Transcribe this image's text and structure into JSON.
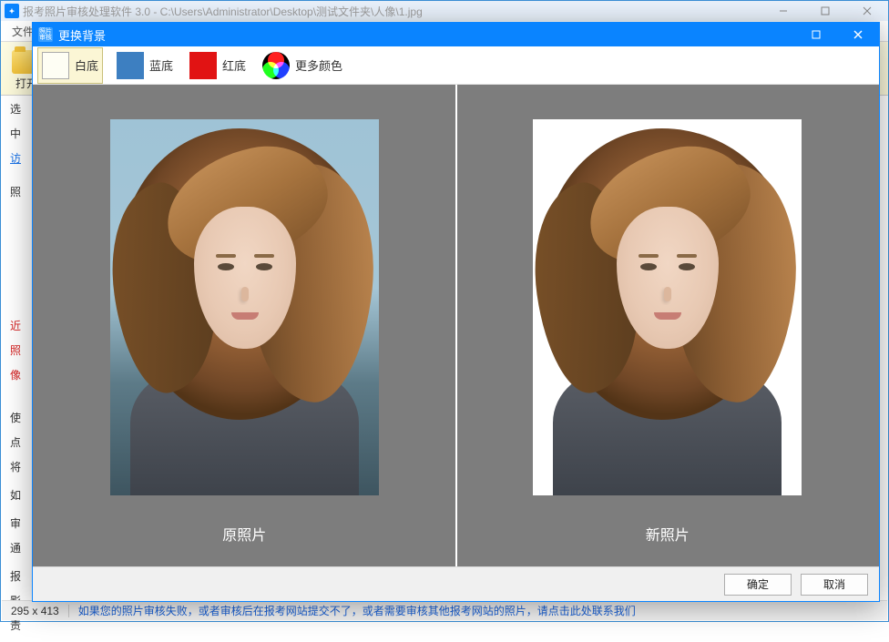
{
  "parent": {
    "title": "报考照片审核处理软件 3.0 - C:\\Users\\Administrator\\Desktop\\测试文件夹\\人像\\1.jpg",
    "menu_file": "文件",
    "toolbar_open": "打开",
    "left_items": {
      "l1": "选",
      "l2": "中",
      "l3": "访",
      "l4": "照",
      "l5": "近",
      "l6": "照",
      "l7": "像",
      "l8": "使",
      "l9": "点",
      "l10": "将",
      "l11": "如",
      "l12": "审",
      "l13": "通",
      "l14": "报",
      "l15": "影",
      "l16": "责"
    }
  },
  "status": {
    "dimensions": "295 x 413",
    "hint": "如果您的照片审核失败，或者审核后在报考网站提交不了，或者需要审核其他报考网站的照片，请点击此处联系我们"
  },
  "modal": {
    "title": "更换背景",
    "icon_text": "照片\n审核",
    "opts": {
      "white": "白底",
      "blue": "蓝底",
      "red": "红底",
      "more": "更多颜色"
    },
    "caption_original": "原照片",
    "caption_new": "新照片",
    "ok": "确定",
    "cancel": "取消"
  }
}
